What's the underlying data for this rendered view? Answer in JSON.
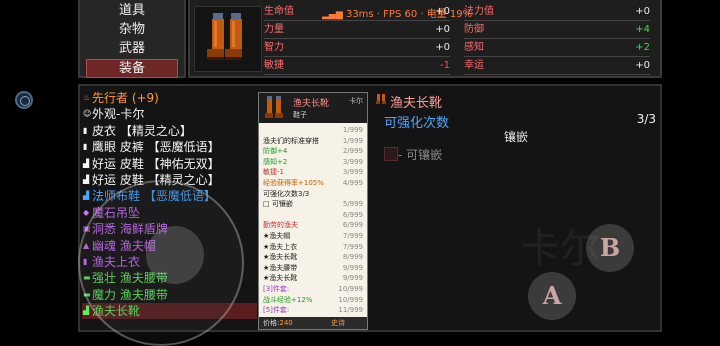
{
  "menu": {
    "items": [
      {
        "label": "道具",
        "active": false
      },
      {
        "label": "杂物",
        "active": false
      },
      {
        "label": "武器",
        "active": false
      },
      {
        "label": "装备",
        "active": true
      }
    ]
  },
  "header": {
    "perf": "33ms · FPS 60 · 电量 19%",
    "stats_left": [
      {
        "label": "生命值",
        "value": "+0",
        "tone": "white"
      },
      {
        "label": "力量",
        "value": "+0",
        "tone": "white"
      },
      {
        "label": "智力",
        "value": "+0",
        "tone": "white"
      },
      {
        "label": "敏捷",
        "value": "-1",
        "tone": "red"
      }
    ],
    "stats_right": [
      {
        "label": "法力值",
        "value": "+0",
        "tone": "white"
      },
      {
        "label": "防御",
        "value": "+4",
        "tone": "green"
      },
      {
        "label": "感知",
        "value": "+2",
        "tone": "green"
      },
      {
        "label": "幸运",
        "value": "+0",
        "tone": "white"
      }
    ]
  },
  "items": [
    {
      "label": "先行者 (+9)",
      "color": "orange",
      "icon": "flame-icon"
    },
    {
      "label": "外观-卡尔",
      "color": "white",
      "icon": "mask-icon"
    },
    {
      "label": "皮衣 【精灵之心】",
      "color": "white",
      "icon": "vest-icon"
    },
    {
      "label": "鹰眼 皮裤 【恶魔低语】",
      "color": "white",
      "icon": "pants-icon"
    },
    {
      "label": "好运 皮鞋 【神佑无双】",
      "color": "white",
      "icon": "boot-icon"
    },
    {
      "label": "好运 皮鞋 【精灵之心】",
      "color": "white",
      "icon": "boot-icon"
    },
    {
      "label": "法师布鞋 【恶魔低语】",
      "color": "blue",
      "icon": "boot-icon"
    },
    {
      "label": "魔石吊坠",
      "color": "purple",
      "icon": "pendant-icon"
    },
    {
      "label": "洞悉 海鲜盾牌",
      "color": "purple",
      "icon": "shield-icon"
    },
    {
      "label": "幽魂 渔夫帽",
      "color": "purple",
      "icon": "hat-icon"
    },
    {
      "label": "渔夫上衣",
      "color": "purple",
      "icon": "shirt-icon"
    },
    {
      "label": "强壮 渔夫腰带",
      "color": "green",
      "icon": "belt-icon"
    },
    {
      "label": "魔力 渔夫腰带",
      "color": "green",
      "icon": "belt-icon"
    },
    {
      "label": "渔夫长靴",
      "color": "green",
      "icon": "boot-icon",
      "selected": true
    }
  ],
  "card": {
    "title": "渔夫长靴",
    "subtitle": "鞋子",
    "owner": "卡尔",
    "lines": [
      {
        "text": "",
        "num": "1/999",
        "tone": ""
      },
      {
        "text": "渔夫们的标准穿搭",
        "num": "1/999",
        "tone": ""
      },
      {
        "text": "防御+4",
        "num": "2/999",
        "tone": "g"
      },
      {
        "text": "感知+2",
        "num": "3/999",
        "tone": "g"
      },
      {
        "text": "敏捷-1",
        "num": "3/999",
        "tone": "r"
      },
      {
        "text": "经验获得率+105%",
        "num": "4/999",
        "tone": "o"
      },
      {
        "text": "可强化次数3/3",
        "num": "",
        "tone": ""
      },
      {
        "text": "□ 可镶嵌",
        "num": "5/999",
        "tone": ""
      },
      {
        "text": "",
        "num": "6/999",
        "tone": ""
      },
      {
        "text": "勤劳的渔夫",
        "num": "6/999",
        "tone": "r"
      },
      {
        "text": "★渔夫帽",
        "num": "7/999",
        "tone": ""
      },
      {
        "text": "★渔夫上衣",
        "num": "7/999",
        "tone": ""
      },
      {
        "text": "★渔夫长靴",
        "num": "8/999",
        "tone": ""
      },
      {
        "text": "★渔夫腰带",
        "num": "9/999",
        "tone": ""
      },
      {
        "text": "★渔夫长靴",
        "num": "9/999",
        "tone": ""
      },
      {
        "text": "[3]件套:",
        "num": "10/999",
        "tone": "p"
      },
      {
        "text": "战斗经验+12%",
        "num": "10/999",
        "tone": "g"
      },
      {
        "text": "[5]件套:",
        "num": "11/999",
        "tone": "p"
      },
      {
        "text": "物品爆率+15%",
        "num": "12/999",
        "tone": "g"
      }
    ],
    "price_label": "价格:",
    "price_value": "240",
    "debug": "史诗"
  },
  "detail": {
    "title": "渔夫长靴",
    "enh_label": "可强化次数",
    "enh_value": "3/3",
    "inlay_header": "镶嵌",
    "inlay_option": "- 可镶嵌"
  },
  "controls": {
    "a_label": "A",
    "b_label": "B"
  },
  "colors": {
    "accent_red": "#6e2626",
    "label_red": "#ff6a6a",
    "green": "#3ddc3d",
    "blue": "#4aa6ff",
    "purple": "#d070ff",
    "orange": "#ff9a3a"
  }
}
